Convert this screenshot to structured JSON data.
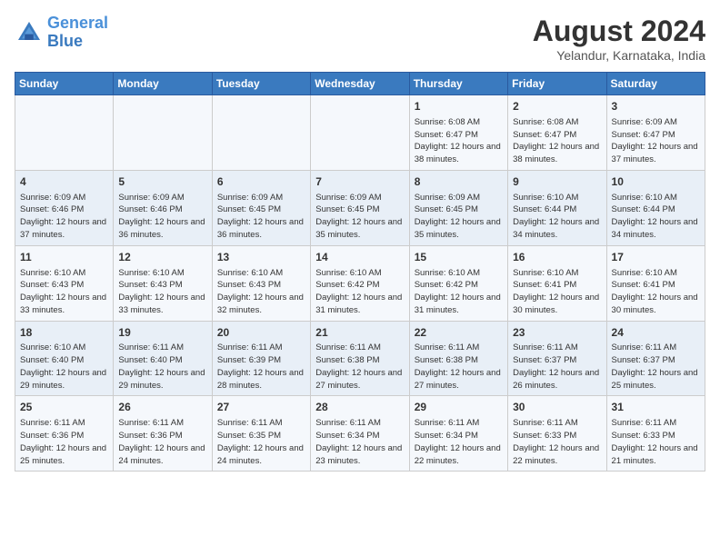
{
  "logo": {
    "line1": "General",
    "line2": "Blue"
  },
  "title": "August 2024",
  "subtitle": "Yelandur, Karnataka, India",
  "days_of_week": [
    "Sunday",
    "Monday",
    "Tuesday",
    "Wednesday",
    "Thursday",
    "Friday",
    "Saturday"
  ],
  "weeks": [
    [
      {
        "day": "",
        "detail": ""
      },
      {
        "day": "",
        "detail": ""
      },
      {
        "day": "",
        "detail": ""
      },
      {
        "day": "",
        "detail": ""
      },
      {
        "day": "1",
        "detail": "Sunrise: 6:08 AM\nSunset: 6:47 PM\nDaylight: 12 hours\nand 38 minutes."
      },
      {
        "day": "2",
        "detail": "Sunrise: 6:08 AM\nSunset: 6:47 PM\nDaylight: 12 hours\nand 38 minutes."
      },
      {
        "day": "3",
        "detail": "Sunrise: 6:09 AM\nSunset: 6:47 PM\nDaylight: 12 hours\nand 37 minutes."
      }
    ],
    [
      {
        "day": "4",
        "detail": "Sunrise: 6:09 AM\nSunset: 6:46 PM\nDaylight: 12 hours\nand 37 minutes."
      },
      {
        "day": "5",
        "detail": "Sunrise: 6:09 AM\nSunset: 6:46 PM\nDaylight: 12 hours\nand 36 minutes."
      },
      {
        "day": "6",
        "detail": "Sunrise: 6:09 AM\nSunset: 6:45 PM\nDaylight: 12 hours\nand 36 minutes."
      },
      {
        "day": "7",
        "detail": "Sunrise: 6:09 AM\nSunset: 6:45 PM\nDaylight: 12 hours\nand 35 minutes."
      },
      {
        "day": "8",
        "detail": "Sunrise: 6:09 AM\nSunset: 6:45 PM\nDaylight: 12 hours\nand 35 minutes."
      },
      {
        "day": "9",
        "detail": "Sunrise: 6:10 AM\nSunset: 6:44 PM\nDaylight: 12 hours\nand 34 minutes."
      },
      {
        "day": "10",
        "detail": "Sunrise: 6:10 AM\nSunset: 6:44 PM\nDaylight: 12 hours\nand 34 minutes."
      }
    ],
    [
      {
        "day": "11",
        "detail": "Sunrise: 6:10 AM\nSunset: 6:43 PM\nDaylight: 12 hours\nand 33 minutes."
      },
      {
        "day": "12",
        "detail": "Sunrise: 6:10 AM\nSunset: 6:43 PM\nDaylight: 12 hours\nand 33 minutes."
      },
      {
        "day": "13",
        "detail": "Sunrise: 6:10 AM\nSunset: 6:43 PM\nDaylight: 12 hours\nand 32 minutes."
      },
      {
        "day": "14",
        "detail": "Sunrise: 6:10 AM\nSunset: 6:42 PM\nDaylight: 12 hours\nand 31 minutes."
      },
      {
        "day": "15",
        "detail": "Sunrise: 6:10 AM\nSunset: 6:42 PM\nDaylight: 12 hours\nand 31 minutes."
      },
      {
        "day": "16",
        "detail": "Sunrise: 6:10 AM\nSunset: 6:41 PM\nDaylight: 12 hours\nand 30 minutes."
      },
      {
        "day": "17",
        "detail": "Sunrise: 6:10 AM\nSunset: 6:41 PM\nDaylight: 12 hours\nand 30 minutes."
      }
    ],
    [
      {
        "day": "18",
        "detail": "Sunrise: 6:10 AM\nSunset: 6:40 PM\nDaylight: 12 hours\nand 29 minutes."
      },
      {
        "day": "19",
        "detail": "Sunrise: 6:11 AM\nSunset: 6:40 PM\nDaylight: 12 hours\nand 29 minutes."
      },
      {
        "day": "20",
        "detail": "Sunrise: 6:11 AM\nSunset: 6:39 PM\nDaylight: 12 hours\nand 28 minutes."
      },
      {
        "day": "21",
        "detail": "Sunrise: 6:11 AM\nSunset: 6:38 PM\nDaylight: 12 hours\nand 27 minutes."
      },
      {
        "day": "22",
        "detail": "Sunrise: 6:11 AM\nSunset: 6:38 PM\nDaylight: 12 hours\nand 27 minutes."
      },
      {
        "day": "23",
        "detail": "Sunrise: 6:11 AM\nSunset: 6:37 PM\nDaylight: 12 hours\nand 26 minutes."
      },
      {
        "day": "24",
        "detail": "Sunrise: 6:11 AM\nSunset: 6:37 PM\nDaylight: 12 hours\nand 25 minutes."
      }
    ],
    [
      {
        "day": "25",
        "detail": "Sunrise: 6:11 AM\nSunset: 6:36 PM\nDaylight: 12 hours\nand 25 minutes."
      },
      {
        "day": "26",
        "detail": "Sunrise: 6:11 AM\nSunset: 6:36 PM\nDaylight: 12 hours\nand 24 minutes."
      },
      {
        "day": "27",
        "detail": "Sunrise: 6:11 AM\nSunset: 6:35 PM\nDaylight: 12 hours\nand 24 minutes."
      },
      {
        "day": "28",
        "detail": "Sunrise: 6:11 AM\nSunset: 6:34 PM\nDaylight: 12 hours\nand 23 minutes."
      },
      {
        "day": "29",
        "detail": "Sunrise: 6:11 AM\nSunset: 6:34 PM\nDaylight: 12 hours\nand 22 minutes."
      },
      {
        "day": "30",
        "detail": "Sunrise: 6:11 AM\nSunset: 6:33 PM\nDaylight: 12 hours\nand 22 minutes."
      },
      {
        "day": "31",
        "detail": "Sunrise: 6:11 AM\nSunset: 6:33 PM\nDaylight: 12 hours\nand 21 minutes."
      }
    ]
  ]
}
